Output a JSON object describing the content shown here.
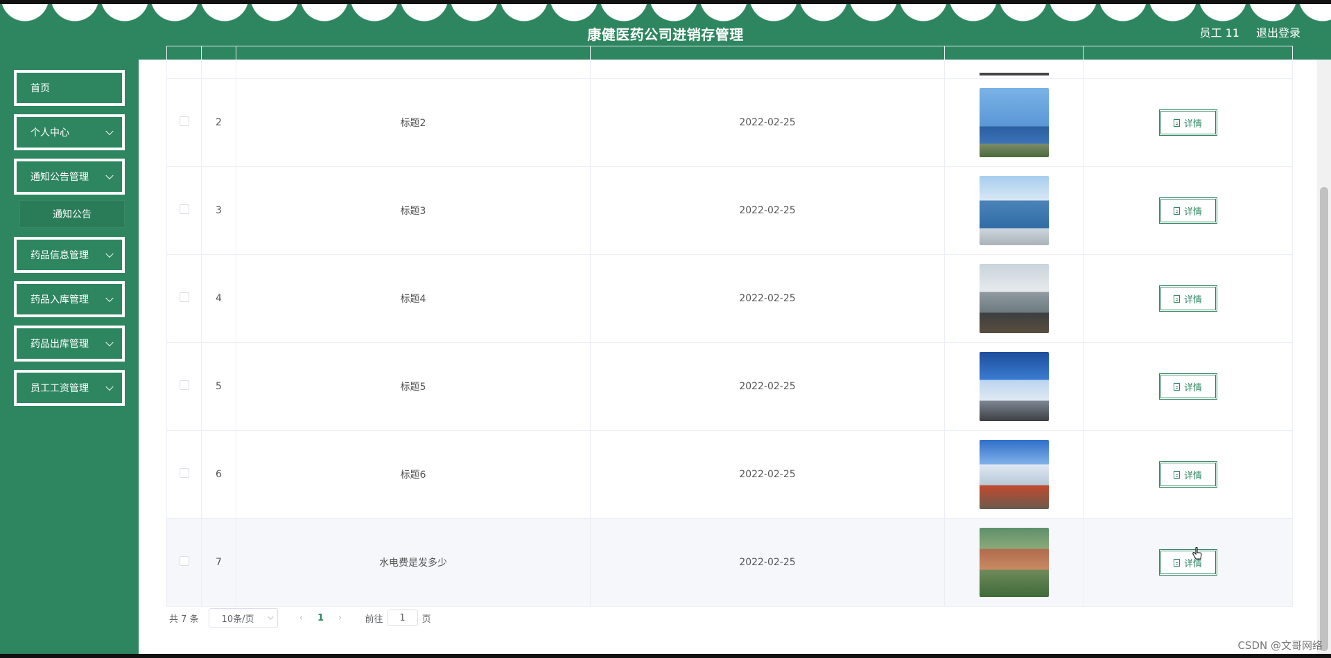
{
  "header": {
    "title": "康健医药公司进销存管理",
    "user": "员工 11",
    "logout": "退出登录"
  },
  "sidebar": {
    "items": [
      {
        "label": "首页"
      },
      {
        "label": "个人中心"
      },
      {
        "label": "通知公告管理"
      },
      {
        "label": "药品信息管理"
      },
      {
        "label": "药品入库管理"
      },
      {
        "label": "药品出库管理"
      },
      {
        "label": "员工工资管理"
      }
    ],
    "submenu": {
      "label": "通知公告"
    }
  },
  "table": {
    "rows": [
      {
        "index": "2",
        "title": "标题2",
        "date": "2022-02-25",
        "image": "building-photo"
      },
      {
        "index": "3",
        "title": "标题3",
        "date": "2022-02-25",
        "image": "building-photo"
      },
      {
        "index": "4",
        "title": "标题4",
        "date": "2022-02-25",
        "image": "building-photo"
      },
      {
        "index": "5",
        "title": "标题5",
        "date": "2022-02-25",
        "image": "building-photo"
      },
      {
        "index": "6",
        "title": "标题6",
        "date": "2022-02-25",
        "image": "building-photo"
      },
      {
        "index": "7",
        "title": "水电费是发多少",
        "date": "2022-02-25",
        "image": "building-photo"
      }
    ],
    "detail_label": "详情",
    "detail_icon": "document-icon"
  },
  "pagination": {
    "total": "共 7 条",
    "page_size": "10条/页",
    "current_page": "1",
    "goto_prefix": "前往",
    "goto_value": "1",
    "goto_suffix": "页",
    "prev_icon": "chevron-left-icon",
    "next_icon": "chevron-right-icon"
  },
  "watermark": "CSDN @文哥网络",
  "colors": {
    "primary": "#2e8660",
    "row_hover": "#f5f7fa",
    "border": "#ebeef5"
  }
}
